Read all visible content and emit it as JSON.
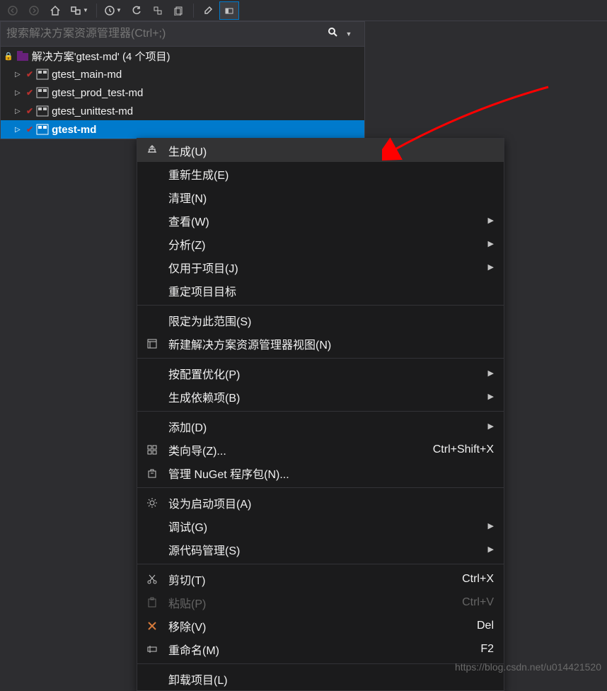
{
  "search": {
    "placeholder": "搜索解决方案资源管理器(Ctrl+;)"
  },
  "solution": {
    "label": "解决方案'gtest-md' (4 个项目)"
  },
  "projects": [
    {
      "label": "gtest_main-md"
    },
    {
      "label": "gtest_prod_test-md"
    },
    {
      "label": "gtest_unittest-md"
    },
    {
      "label": "gtest-md"
    }
  ],
  "menu": {
    "build": "生成(U)",
    "rebuild": "重新生成(E)",
    "clean": "清理(N)",
    "view": "查看(W)",
    "analyze": "分析(Z)",
    "project_only": "仅用于项目(J)",
    "retarget": "重定项目目标",
    "scope": "限定为此范围(S)",
    "new_view": "新建解决方案资源管理器视图(N)",
    "optimize": "按配置优化(P)",
    "build_deps": "生成依赖项(B)",
    "add": "添加(D)",
    "class_wizard": "类向导(Z)...",
    "class_wizard_sc": "Ctrl+Shift+X",
    "nuget": "管理 NuGet 程序包(N)...",
    "startup": "设为启动项目(A)",
    "debug": "调试(G)",
    "scm": "源代码管理(S)",
    "cut": "剪切(T)",
    "cut_sc": "Ctrl+X",
    "paste": "粘贴(P)",
    "paste_sc": "Ctrl+V",
    "remove": "移除(V)",
    "remove_sc": "Del",
    "rename": "重命名(M)",
    "rename_sc": "F2",
    "unload": "卸载项目(L)"
  },
  "watermark": "https://blog.csdn.net/u014421520"
}
